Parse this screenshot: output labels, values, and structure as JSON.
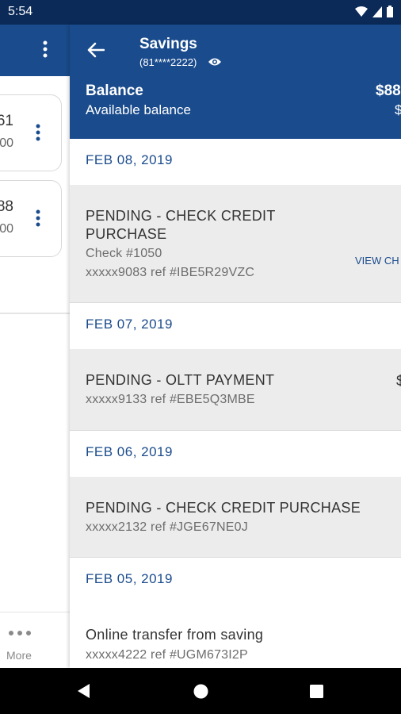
{
  "status_bar": {
    "time": "5:54"
  },
  "left_panel": {
    "cards": [
      {
        "top_value": "61",
        "bottom_value": "00"
      },
      {
        "top_value": "88",
        "bottom_value": "00"
      }
    ],
    "more_label": "More"
  },
  "header": {
    "title": "Savings",
    "account_number": "(81****2222)",
    "balance_label": "Balance",
    "available_label": "Available balance",
    "balance_amount": "$88",
    "available_amount": "$"
  },
  "transactions": [
    {
      "date": "FEB 08, 2019",
      "title_line1": "PENDING - CHECK CREDIT",
      "title_line2": "PURCHASE",
      "line3": "Check #1050",
      "line4": "xxxxx9083 ref #IBE5R29VZC",
      "action": "VIEW CH"
    },
    {
      "date": "FEB 07, 2019",
      "title_line1": "PENDING - OLTT PAYMENT",
      "line3": "xxxxx9133 ref #EBE5Q3MBE",
      "right": "$"
    },
    {
      "date": "FEB 06, 2019",
      "title_line1": "PENDING - CHECK CREDIT PURCHASE",
      "line3": "xxxxx2132 ref #JGE67NE0J"
    },
    {
      "date": "FEB 05, 2019",
      "title_line1": "Online transfer from saving",
      "line3": "xxxxx4222 ref #UGM673I2P"
    }
  ],
  "colors": {
    "primary": "#1a4b8c",
    "status_bar": "#0b2a58",
    "row_bg": "#ececec"
  }
}
